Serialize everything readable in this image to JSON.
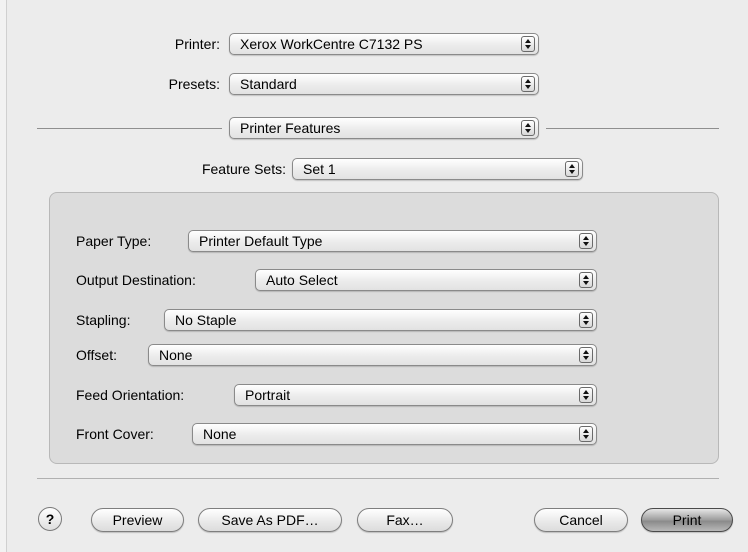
{
  "printer": {
    "label": "Printer:",
    "value": "Xerox WorkCentre C7132 PS"
  },
  "presets": {
    "label": "Presets:",
    "value": "Standard"
  },
  "panel": {
    "value": "Printer Features"
  },
  "feature_sets": {
    "label": "Feature Sets:",
    "value": "Set 1"
  },
  "features": [
    {
      "label": "Paper Type:",
      "value": "Printer Default Type"
    },
    {
      "label": "Output Destination:",
      "value": "Auto Select"
    },
    {
      "label": "Stapling:",
      "value": "No Staple"
    },
    {
      "label": "Offset:",
      "value": "None"
    },
    {
      "label": "Feed Orientation:",
      "value": "Portrait"
    },
    {
      "label": "Front Cover:",
      "value": "None"
    }
  ],
  "buttons": {
    "help": "?",
    "preview": "Preview",
    "save_pdf": "Save As PDF…",
    "fax": "Fax…",
    "cancel": "Cancel",
    "print": "Print"
  },
  "icons": {
    "popup": "updown-arrows-icon",
    "help": "question-mark-icon"
  }
}
